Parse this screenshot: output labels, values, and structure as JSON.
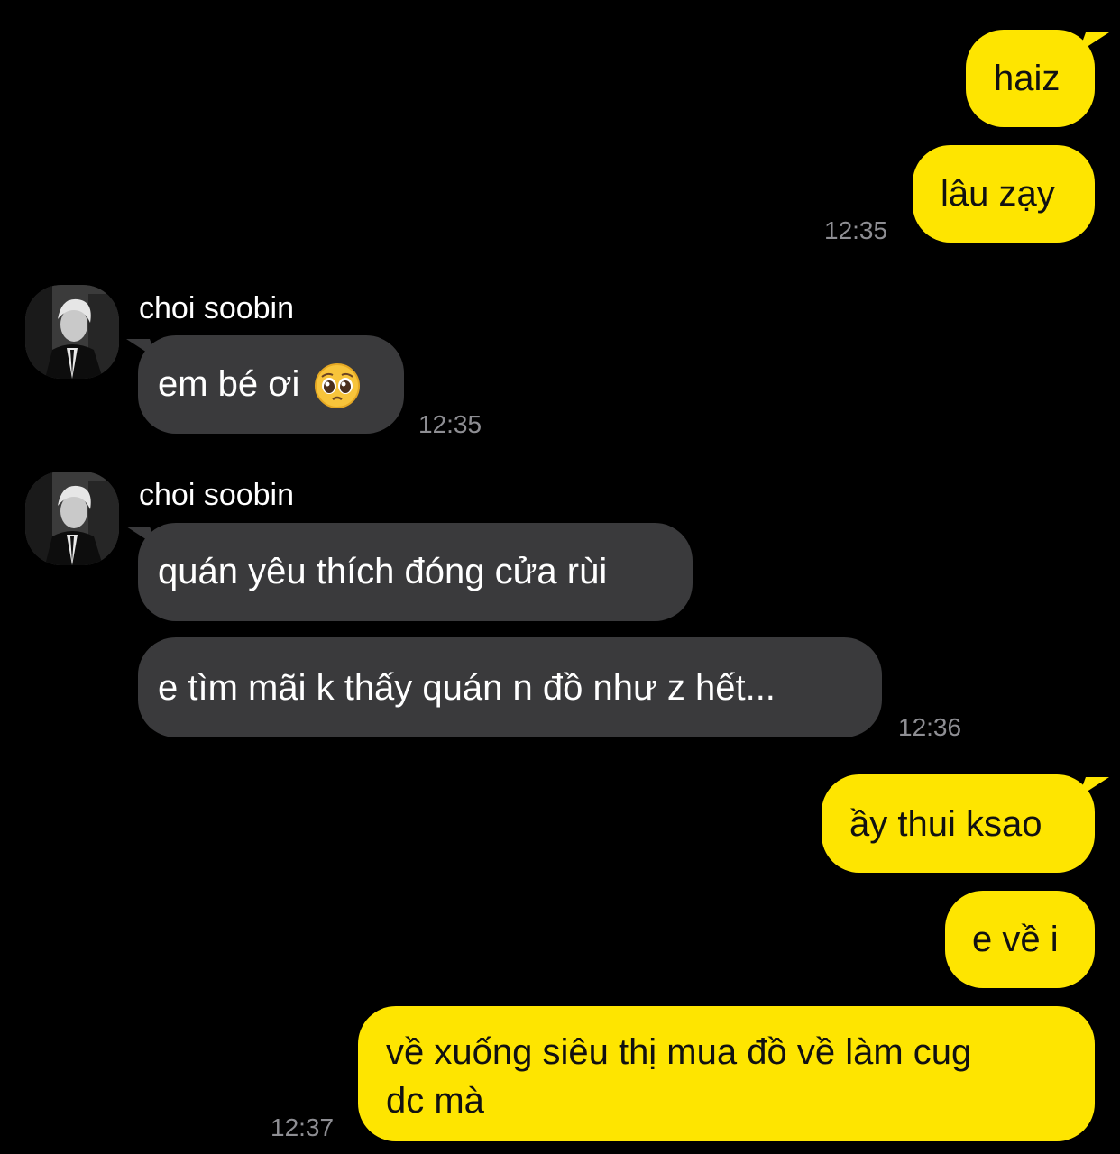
{
  "contact": {
    "name": "choi soobin"
  },
  "messages": [
    {
      "text": "haiz"
    },
    {
      "text": "lâu zạy"
    },
    {
      "time": "12:35"
    },
    {
      "text": "em bé ơi"
    },
    {
      "time": "12:35"
    },
    {
      "text": "quán yêu thích đóng cửa rùi"
    },
    {
      "text": "e tìm mãi k thấy quán n đồ như z hết..."
    },
    {
      "time": "12:36"
    },
    {
      "text": "ầy thui ksao"
    },
    {
      "text": "e về i"
    },
    {
      "text_line1": "về xuống siêu thị mua đồ về làm cug",
      "text_line2": "dc mà"
    },
    {
      "time": "12:37"
    }
  ],
  "colors": {
    "background": "#000000",
    "sent_bubble": "#fee500",
    "received_bubble": "#3a3a3c",
    "timestamp": "#8e8e93"
  },
  "icons": {
    "avatar": "profile-photo",
    "emoji": "pleading-face-emoji"
  }
}
